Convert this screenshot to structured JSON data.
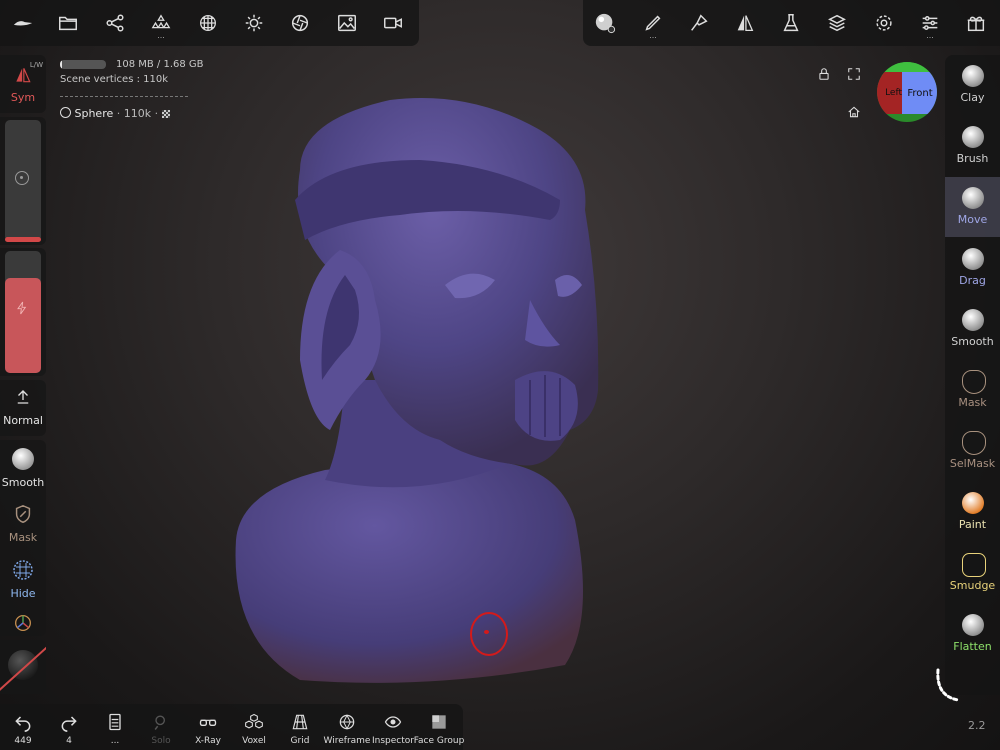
{
  "memory": {
    "used": "108 MB / 1.68 GB",
    "fill": 0.04
  },
  "scene": {
    "vertices_label": "Scene vertices :",
    "vertices_value": "110k",
    "object_name": "Sphere",
    "object_verts": "110k"
  },
  "sym": {
    "label": "Sym",
    "badge": "L/W"
  },
  "left_tools": {
    "normal": "Normal",
    "smooth": "Smooth",
    "mask": "Mask",
    "hide": "Hide"
  },
  "right_tools": [
    {
      "label": "Clay",
      "color": "#d0d0d0"
    },
    {
      "label": "Brush",
      "color": "#d0d0d0"
    },
    {
      "label": "Move",
      "color": "#9fa6e6",
      "selected": true
    },
    {
      "label": "Drag",
      "color": "#9fa6e6"
    },
    {
      "label": "Smooth",
      "color": "#d0d0d0"
    },
    {
      "label": "Mask",
      "color": "#a89080"
    },
    {
      "label": "SelMask",
      "color": "#a89080"
    },
    {
      "label": "Paint",
      "color": "#e9e0b0"
    },
    {
      "label": "Smudge",
      "color": "#e8d27a"
    },
    {
      "label": "Flatten",
      "color": "#8ee06a"
    }
  ],
  "gizmo": {
    "left": "Left",
    "front": "Front"
  },
  "bottom": {
    "undo_count": "449",
    "redo_count": "4",
    "more": "...",
    "solo": "Solo",
    "xray": "X-Ray",
    "voxel": "Voxel",
    "grid": "Grid",
    "wireframe": "Wireframe",
    "inspector": "Inspector",
    "facegroup": "Face Group"
  },
  "version": "2.2"
}
